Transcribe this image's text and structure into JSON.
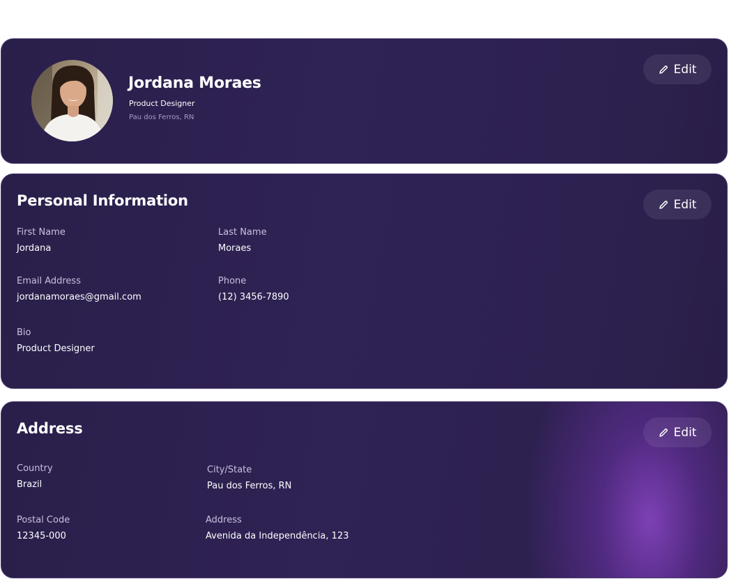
{
  "profile": {
    "name": "Jordana Moraes",
    "role": "Product Designer",
    "location": "Pau dos Ferros, RN",
    "edit_label": "Edit"
  },
  "personal": {
    "title": "Personal Information",
    "edit_label": "Edit",
    "fields": [
      {
        "label": "First Name",
        "value": "Jordana"
      },
      {
        "label": "Last Name",
        "value": "Moraes"
      },
      {
        "label": "Email Address",
        "value": "jordanamoraes@gmail.com"
      },
      {
        "label": "Phone",
        "value": "(12) 3456-7890"
      },
      {
        "label": "Bio",
        "value": "Product Designer"
      }
    ]
  },
  "address": {
    "title": "Address",
    "edit_label": "Edit",
    "fields": [
      {
        "label": "Country",
        "value": "Brazil"
      },
      {
        "label": "City/State",
        "value": "Pau dos Ferros, RN"
      },
      {
        "label": "Postal Code",
        "value": "12345-000"
      },
      {
        "label": "Address",
        "value": "Avenida da Independência, 123"
      }
    ]
  },
  "icons": {
    "edit": "pencil-icon",
    "avatar": "avatar"
  },
  "colors": {
    "card_bg": "#2d2150",
    "accent_glow": "#8c46c8",
    "label": "#c9c0de",
    "muted": "#a99bc7"
  }
}
